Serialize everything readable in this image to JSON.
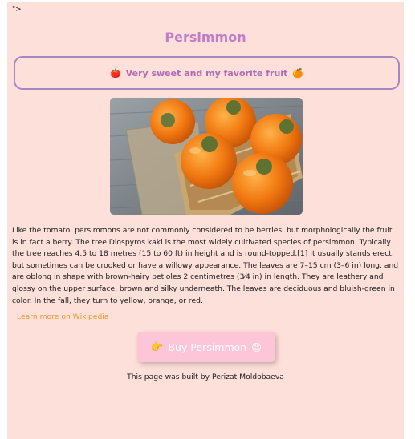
{
  "stray_text": "\">",
  "title": "Persimmon",
  "banner": {
    "left_emoji": "🍅",
    "text": "Very sweet and my favorite fruit",
    "right_emoji": "🍊"
  },
  "image": {
    "subject": "persimmons-in-basket"
  },
  "description": "Like the tomato, persimmons are not commonly considered to be berries, but morphologically the fruit is in fact a berry. The tree Diospyros kaki is the most widely cultivated species of persimmon. Typically the tree reaches 4.5 to 18 metres (15 to 60 ft) in height and is round-topped.[1] It usually stands erect, but sometimes can be crooked or have a willowy appearance. The leaves are 7–15 cm (3–6 in) long, and are oblong in shape with brown-hairy petioles 2 centimetres (3⁄4 in) in length. They are leathery and glossy on the upper surface, brown and silky underneath. The leaves are deciduous and bluish-green in color. In the fall, they turn to yellow, orange, or red.",
  "wiki_link": "Learn more on Wikipedia",
  "buy_button": {
    "left_emoji": "👉",
    "label": "Buy Persimmon",
    "right_emoji": "😊"
  },
  "credit": "This page was built by Perizat Moldobaeva",
  "colors": {
    "page_background": "#fde0d9",
    "title": "#c07ec7",
    "banner_border": "#a587c4",
    "banner_text": "#b06ab8",
    "link": "#e39b2b",
    "button_background": "#fdc6d8",
    "button_text": "#ffffff"
  }
}
